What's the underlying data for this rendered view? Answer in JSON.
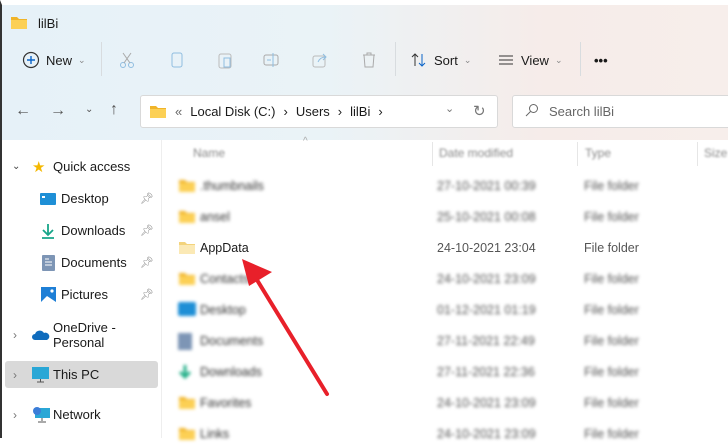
{
  "window": {
    "title": "lilBi"
  },
  "toolbar": {
    "new_label": "New",
    "sort_label": "Sort",
    "view_label": "View",
    "more_label": "•••"
  },
  "address": {
    "prefix": "«",
    "crumbs": [
      "Local Disk (C:)",
      "Users",
      "lilBi"
    ],
    "sep": "›"
  },
  "search": {
    "placeholder": "Search lilBi"
  },
  "columns": {
    "name": "Name",
    "date": "Date modified",
    "type": "Type",
    "size": "Size"
  },
  "files": [
    {
      "name": ".thumbnails",
      "date": "27-10-2021 00:39",
      "type": "File folder",
      "icon": "folder",
      "blurred": true
    },
    {
      "name": "ansel",
      "date": "25-10-2021 00:08",
      "type": "File folder",
      "icon": "folder",
      "blurred": true
    },
    {
      "name": "AppData",
      "date": "24-10-2021 23:04",
      "type": "File folder",
      "icon": "folder-hidden",
      "blurred": false
    },
    {
      "name": "Contacts",
      "date": "24-10-2021 23:09",
      "type": "File folder",
      "icon": "folder",
      "blurred": true
    },
    {
      "name": "Desktop",
      "date": "01-12-2021 01:19",
      "type": "File folder",
      "icon": "desktop",
      "blurred": true
    },
    {
      "name": "Documents",
      "date": "27-11-2021 22:49",
      "type": "File folder",
      "icon": "documents",
      "blurred": true
    },
    {
      "name": "Downloads",
      "date": "27-11-2021 22:36",
      "type": "File folder",
      "icon": "downloads",
      "blurred": true
    },
    {
      "name": "Favorites",
      "date": "24-10-2021 23:09",
      "type": "File folder",
      "icon": "folder",
      "blurred": true
    },
    {
      "name": "Links",
      "date": "24-10-2021 23:09",
      "type": "File folder",
      "icon": "folder",
      "blurred": true
    }
  ],
  "sidebar": {
    "quick_access": "Quick access",
    "items": [
      {
        "label": "Desktop"
      },
      {
        "label": "Downloads"
      },
      {
        "label": "Documents"
      },
      {
        "label": "Pictures"
      }
    ],
    "onedrive": "OneDrive - Personal",
    "thispc": "This PC",
    "network": "Network"
  },
  "annotation": {
    "color": "#e8202a"
  }
}
